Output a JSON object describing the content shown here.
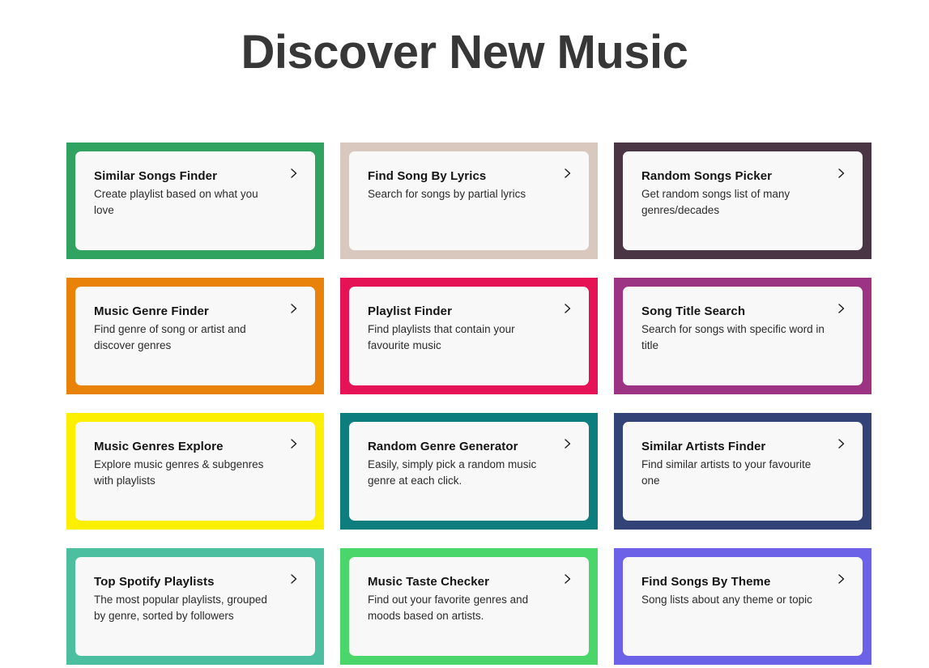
{
  "header": {
    "title": "Discover New Music",
    "title_color": "#373737"
  },
  "theme": {
    "page_background": "#ffffff",
    "card_inner_background": "#f8f8f8",
    "title_text_color": "#141414",
    "description_text_color": "#2b2b2b"
  },
  "grid": {
    "columns": 3,
    "chevron_icon": "chevron-right-icon",
    "cards": [
      {
        "title": "Similar Songs Finder",
        "description": "Create playlist based on what you love",
        "accent_color": "#2fa35f"
      },
      {
        "title": "Find Song By Lyrics",
        "description": "Search for songs by partial lyrics",
        "accent_color": "#d9c8bd"
      },
      {
        "title": "Random Songs Picker",
        "description": "Get random songs list of many genres/decades",
        "accent_color": "#4a3545"
      },
      {
        "title": "Music Genre Finder",
        "description": "Find genre of song or artist and discover genres",
        "accent_color": "#e88208"
      },
      {
        "title": "Playlist Finder",
        "description": "Find playlists that contain your favourite music",
        "accent_color": "#e51255"
      },
      {
        "title": "Song Title Search",
        "description": "Search for songs with specific word in title",
        "accent_color": "#9c3383"
      },
      {
        "title": "Music Genres Explore",
        "description": "Explore music genres & subgenres with playlists",
        "accent_color": "#fcf000"
      },
      {
        "title": "Random Genre Generator",
        "description": "Easily, simply pick a random music genre at each click.",
        "accent_color": "#0d7d7d"
      },
      {
        "title": "Similar Artists Finder",
        "description": "Find similar artists to your favourite one",
        "accent_color": "#334377"
      },
      {
        "title": "Top Spotify Playlists",
        "description": "The most popular playlists, grouped by genre, sorted by followers",
        "accent_color": "#4cbfa0"
      },
      {
        "title": "Music Taste Checker",
        "description": "Find out your favorite genres and moods based on artists.",
        "accent_color": "#4bd66c"
      },
      {
        "title": "Find Songs By Theme",
        "description": "Song lists about any theme or topic",
        "accent_color": "#6c62e8"
      }
    ]
  }
}
